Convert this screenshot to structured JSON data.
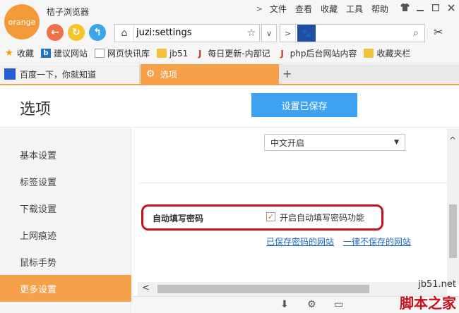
{
  "app": {
    "logo_text": "orange",
    "name": "桔子浏览器"
  },
  "menubar": {
    "arrow": ">",
    "items": [
      "文件",
      "查看",
      "收藏",
      "工具",
      "帮助"
    ],
    "window_controls": [
      "shirt-icon",
      "minimize-icon",
      "maximize-icon",
      "close-icon"
    ]
  },
  "toolbar": {
    "back_glyph": "←",
    "refresh_glyph": "↻",
    "home_glyph": "↰",
    "address_home_glyph": "⌂",
    "url": "juzi:settings",
    "star_glyph": "☆",
    "dropdown_glyph": "∨",
    "forward_glyph": ">",
    "search_engine_glyph": "🐾",
    "search_value": "",
    "search_glyph": "⌕",
    "scissors_glyph": "✂"
  },
  "bookmarks": [
    {
      "label": "收藏",
      "icon": "star-icon",
      "glyph": "★"
    },
    {
      "label": "建议网站",
      "icon": "bing-icon",
      "glyph": "b"
    },
    {
      "label": "网页快讯库",
      "icon": "page-icon",
      "glyph": ""
    },
    {
      "label": "jb51",
      "icon": "folder-icon",
      "glyph": ""
    },
    {
      "label": "每日更新-内部记",
      "icon": "jb-icon",
      "glyph": "J"
    },
    {
      "label": "php后台网站内容",
      "icon": "jb-icon",
      "glyph": "J"
    },
    {
      "label": "收藏夹栏",
      "icon": "folder-icon",
      "glyph": ""
    }
  ],
  "tabs": [
    {
      "label": "百度一下，你就知道",
      "icon": "baidu-icon",
      "glyph": "🐾",
      "active": false
    },
    {
      "label": "选项",
      "icon": "settings-icon",
      "glyph": "⚙",
      "active": true
    }
  ],
  "new_tab_glyph": "+",
  "settings": {
    "title": "选项",
    "saved_button": "设置已保存",
    "sidebar": [
      "基本设置",
      "标签设置",
      "下载设置",
      "上网痕迹",
      "鼠标手势",
      "更多设置"
    ],
    "active_index": 5,
    "select_value": "中文开启",
    "select_arrow": "▼",
    "autofill": {
      "label": "自动填写密码",
      "checkbox_checked": true,
      "check_glyph": "✓",
      "checkbox_label": "开启自动填写密码功能",
      "link_saved": "已保存密码的网站",
      "link_never": "一律不保存的网站"
    }
  },
  "scrollbars": {
    "left_glyph": "<",
    "up_glyph": "^"
  },
  "statusbar_icons": [
    {
      "name": "download-icon",
      "glyph": "⬇"
    },
    {
      "name": "settings-icon",
      "glyph": "⚙"
    },
    {
      "name": "window-icon",
      "glyph": "▭"
    }
  ],
  "watermark": {
    "small": "jb51.net",
    "large": "脚本之家"
  },
  "colors": {
    "accent": "#f7a04a",
    "primary_button": "#3fa2f0",
    "highlight_border": "#c8101a",
    "link": "#1a66c9"
  }
}
